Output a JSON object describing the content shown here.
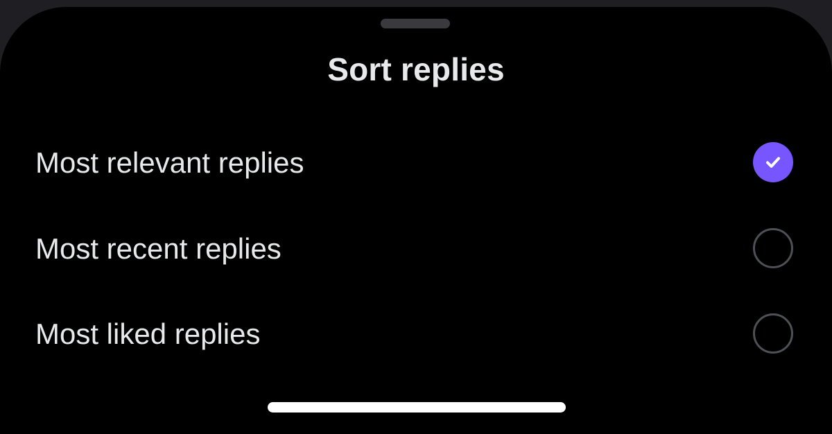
{
  "sheet": {
    "title": "Sort replies"
  },
  "options": [
    {
      "label": "Most relevant replies",
      "selected": true
    },
    {
      "label": "Most recent replies",
      "selected": false
    },
    {
      "label": "Most liked replies",
      "selected": false
    }
  ],
  "colors": {
    "accent": "#7856ff",
    "background": "#000000",
    "text": "#e7e9ea",
    "radio_border": "#4d5156",
    "grabber": "#3a3a3e"
  },
  "icons": {
    "selected": "checkmark-icon"
  }
}
